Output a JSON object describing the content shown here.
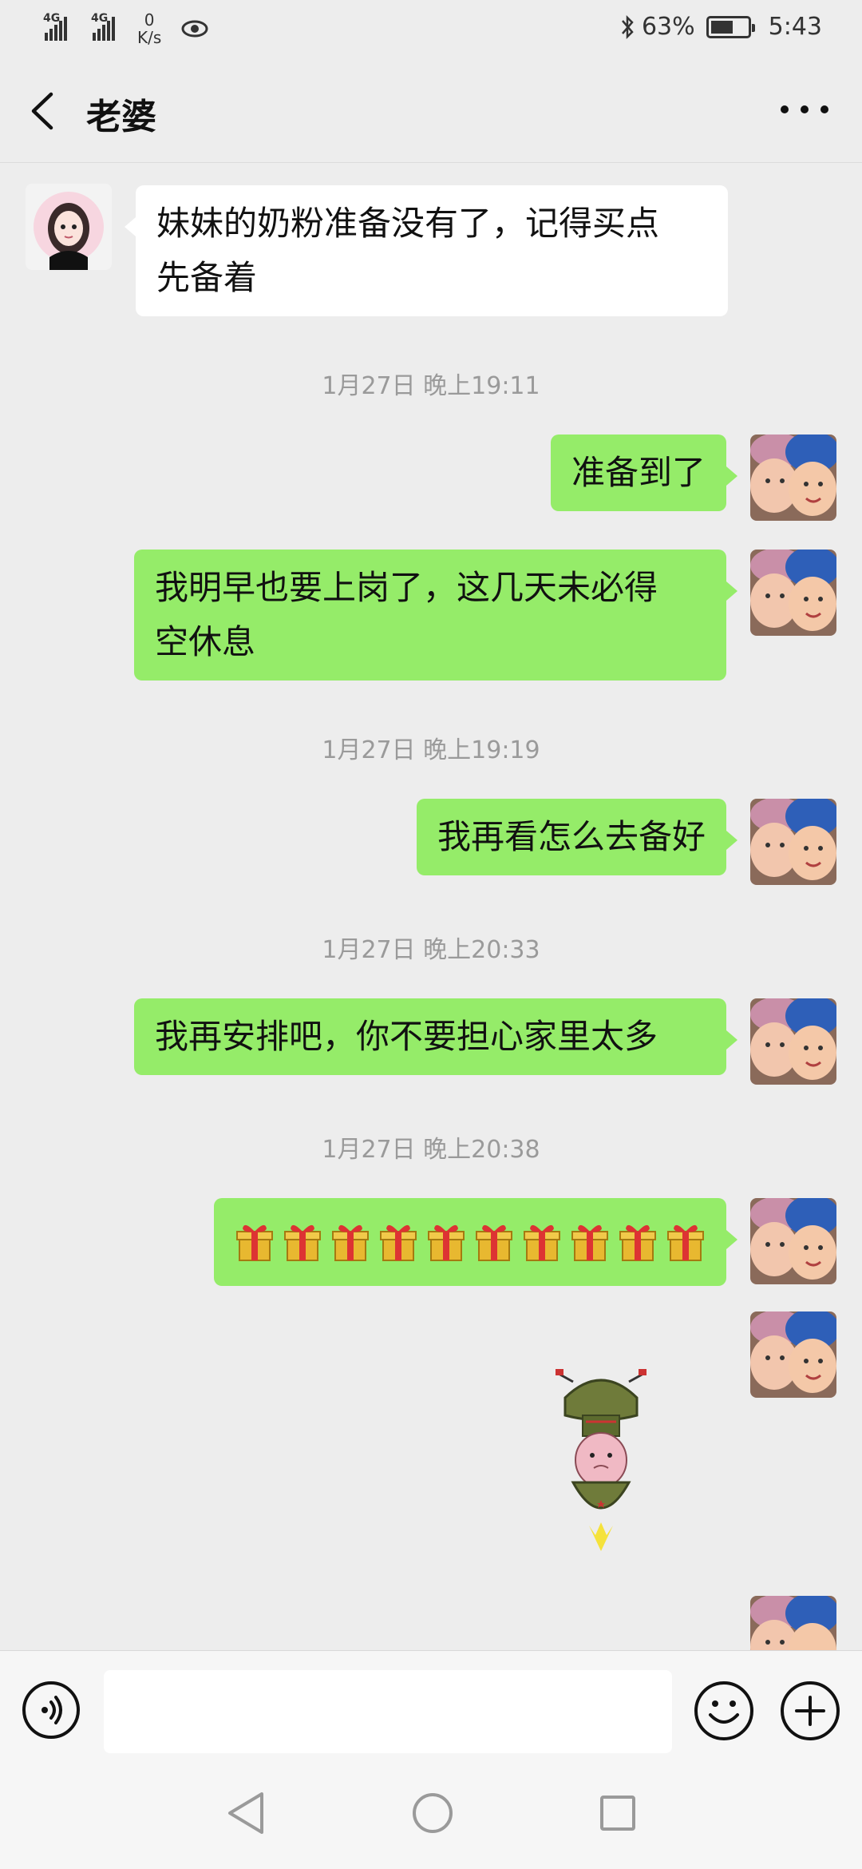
{
  "status_bar": {
    "network_1": "4G",
    "network_2": "4G",
    "net_speed_value": "0",
    "net_speed_unit": "K/s",
    "battery": "63%",
    "time": "5:43",
    "battery_level": 0.63
  },
  "header": {
    "title": "老婆",
    "back_icon": "chevron-left-icon",
    "more_icon": "more-dots-icon"
  },
  "messages": [
    {
      "type": "incoming",
      "text_line1": "妹妹的奶粉准备没有了，记得买点",
      "text_line2": "先备着"
    },
    {
      "type": "timestamp",
      "text": "1月27日 晚上19:11"
    },
    {
      "type": "outgoing",
      "text": "准备到了"
    },
    {
      "type": "outgoing",
      "text_line1": "我明早也要上岗了，这几天未必得",
      "text_line2": "空休息"
    },
    {
      "type": "timestamp",
      "text": "1月27日 晚上19:19"
    },
    {
      "type": "outgoing",
      "text": "我再看怎么去备好"
    },
    {
      "type": "timestamp",
      "text": "1月27日 晚上20:33"
    },
    {
      "type": "outgoing",
      "text": "我再安排吧，你不要担心家里太多"
    },
    {
      "type": "timestamp",
      "text": "1月27日 晚上20:38"
    },
    {
      "type": "outgoing_emoji",
      "emoji": "gift-icon",
      "count": 10
    },
    {
      "type": "outgoing_sticker",
      "sticker": "soldier-sticker"
    }
  ],
  "input_bar": {
    "voice_icon": "voice-icon",
    "placeholder": "",
    "emoji_icon": "smiley-icon",
    "plus_icon": "plus-icon"
  },
  "nav_bar": {
    "back": "triangle-back-icon",
    "home": "circle-home-icon",
    "recent": "square-recent-icon"
  },
  "colors": {
    "background": "#ededed",
    "outgoing_bubble": "#95ec69",
    "incoming_bubble": "#ffffff",
    "timestamp": "#9a9a9a"
  }
}
